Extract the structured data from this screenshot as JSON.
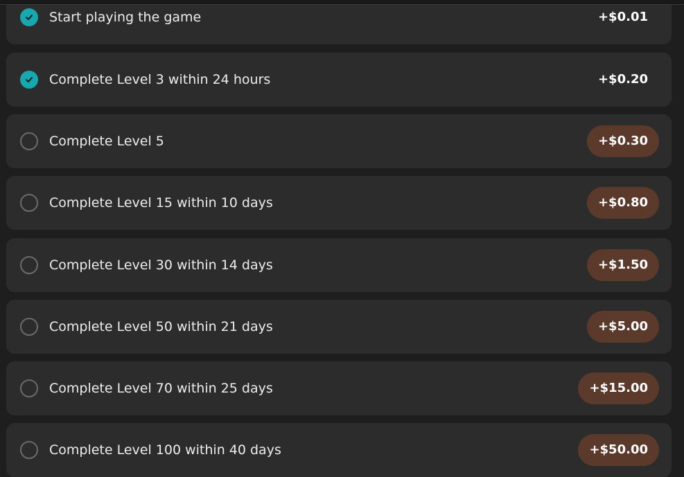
{
  "tasks": [
    {
      "label": "Start playing the game",
      "reward": "+$0.01",
      "completed": true,
      "check_icon": "check-circle-icon"
    },
    {
      "label": "Complete Level 3 within 24 hours",
      "reward": "+$0.20",
      "completed": true,
      "check_icon": "check-circle-icon"
    },
    {
      "label": "Complete Level 5",
      "reward": "+$0.30",
      "completed": false,
      "check_icon": "empty-circle-icon"
    },
    {
      "label": "Complete Level 15 within 10 days",
      "reward": "+$0.80",
      "completed": false,
      "check_icon": "empty-circle-icon"
    },
    {
      "label": "Complete Level 30 within 14 days",
      "reward": "+$1.50",
      "completed": false,
      "check_icon": "empty-circle-icon"
    },
    {
      "label": "Complete Level 50 within 21 days",
      "reward": "+$5.00",
      "completed": false,
      "check_icon": "empty-circle-icon"
    },
    {
      "label": "Complete Level 70 within 25 days",
      "reward": "+$15.00",
      "completed": false,
      "check_icon": "empty-circle-icon"
    },
    {
      "label": "Complete Level 100 within 40 days",
      "reward": "+$50.00",
      "completed": false,
      "check_icon": "empty-circle-icon"
    }
  ],
  "colors": {
    "background": "#1e1e1e",
    "card": "#2c2c2c",
    "completed_check": "#17a7ae",
    "pending_reward_pill": "#5b3a2b",
    "text": "#ededed"
  }
}
